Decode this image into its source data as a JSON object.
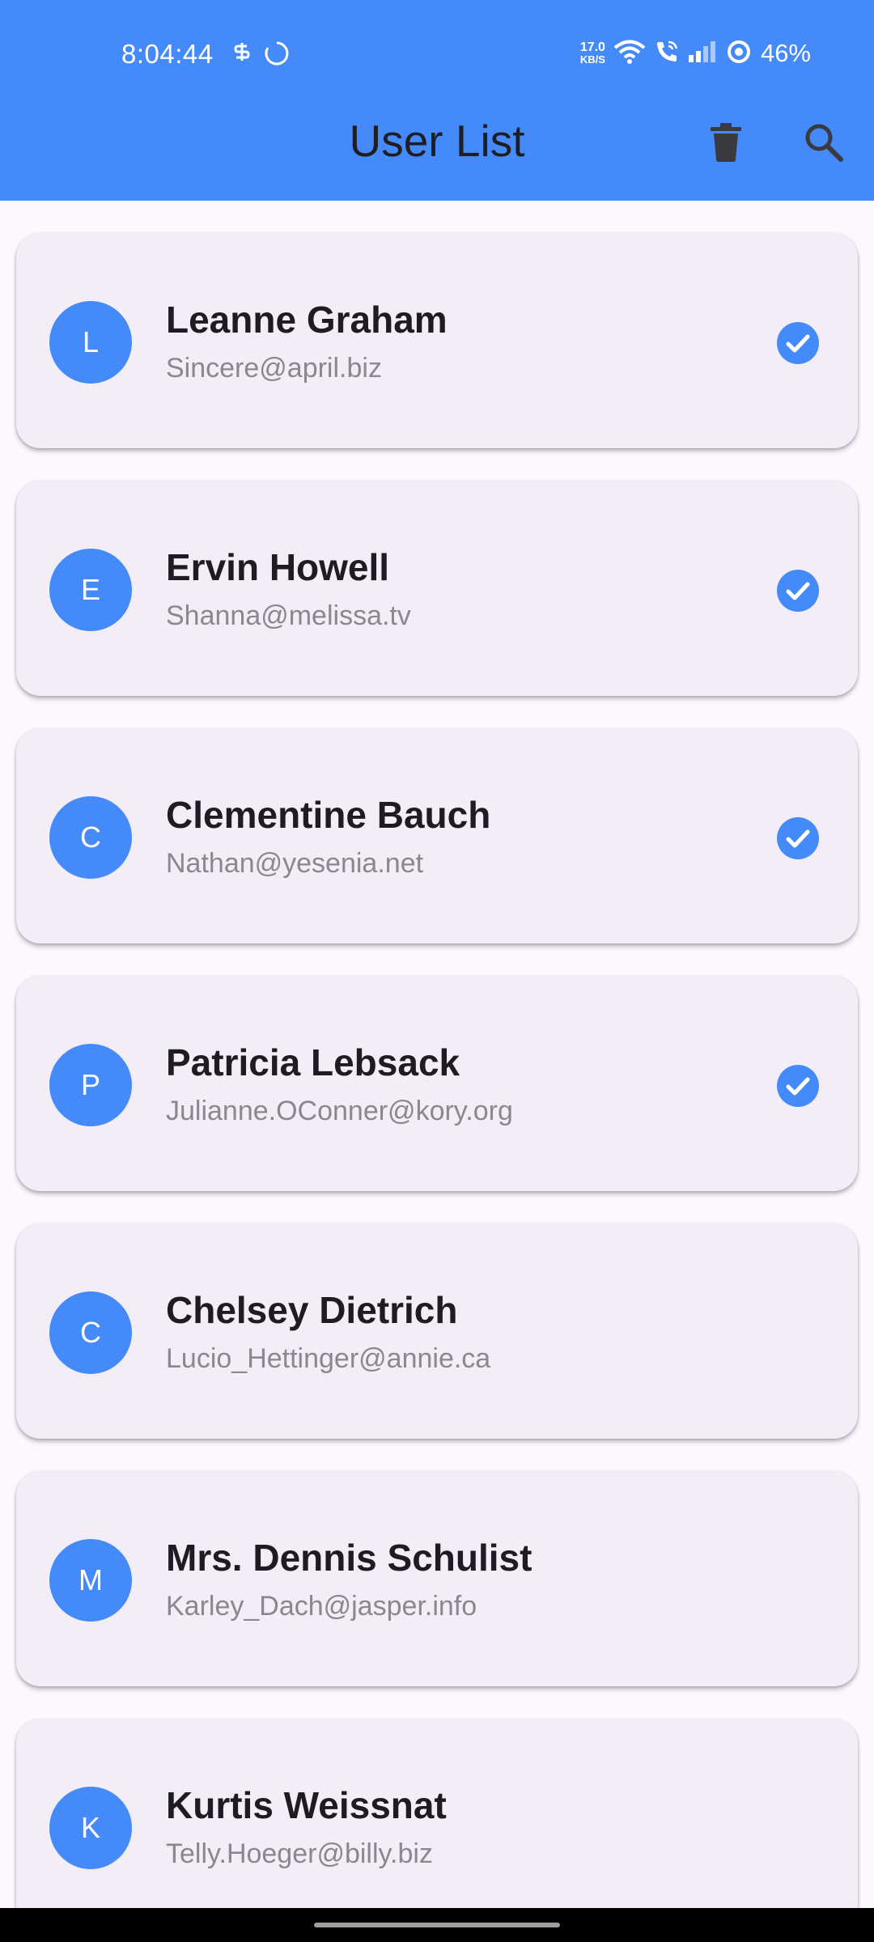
{
  "status_bar": {
    "time": "8:04:44",
    "speed_value": "17.0",
    "speed_unit": "KB/S",
    "battery": "46%"
  },
  "app_bar": {
    "title": "User List",
    "delete_icon": "trash-icon",
    "search_icon": "search-icon"
  },
  "colors": {
    "primary": "#458AF9",
    "background": "#FDF7FF",
    "card": "#F3EDF7"
  },
  "users": [
    {
      "initial": "L",
      "name": "Leanne Graham",
      "email": "Sincere@april.biz",
      "selected": true
    },
    {
      "initial": "E",
      "name": "Ervin Howell",
      "email": "Shanna@melissa.tv",
      "selected": true
    },
    {
      "initial": "C",
      "name": "Clementine Bauch",
      "email": "Nathan@yesenia.net",
      "selected": true
    },
    {
      "initial": "P",
      "name": "Patricia Lebsack",
      "email": "Julianne.OConner@kory.org",
      "selected": true
    },
    {
      "initial": "C",
      "name": "Chelsey Dietrich",
      "email": "Lucio_Hettinger@annie.ca",
      "selected": false
    },
    {
      "initial": "M",
      "name": "Mrs. Dennis Schulist",
      "email": "Karley_Dach@jasper.info",
      "selected": false
    },
    {
      "initial": "K",
      "name": "Kurtis Weissnat",
      "email": "Telly.Hoeger@billy.biz",
      "selected": false
    }
  ]
}
